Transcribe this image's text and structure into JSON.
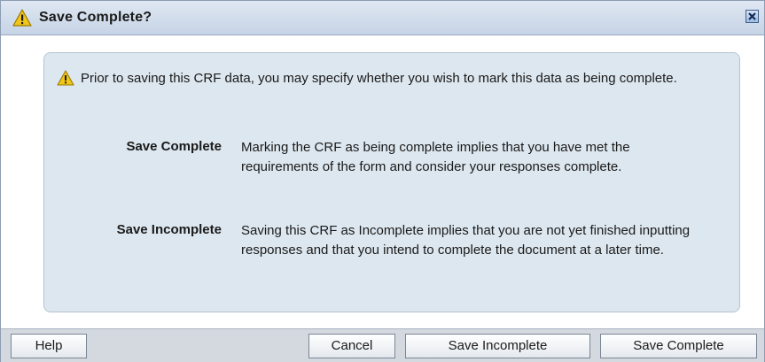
{
  "dialog": {
    "title": "Save Complete?",
    "close_icon": "close-icon"
  },
  "content": {
    "intro": "Prior to saving this CRF data, you may specify whether you wish to mark this data as being complete.",
    "options": [
      {
        "label": "Save Complete",
        "description": "Marking the CRF as being complete implies that you have met the requirements of the form and consider your responses complete."
      },
      {
        "label": "Save Incomplete",
        "description": "Saving this CRF as Incomplete implies that you are not yet finished inputting responses and that you intend to complete the document at a later time."
      }
    ]
  },
  "footer": {
    "help_label": "Help",
    "cancel_label": "Cancel",
    "save_incomplete_label": "Save Incomplete",
    "save_complete_label": "Save Complete"
  },
  "colors": {
    "titlebar": "#c6d4e6",
    "content_panel": "#dde7ef",
    "warning": "#f2c618"
  },
  "icons": [
    "warning-icon",
    "close-icon"
  ]
}
